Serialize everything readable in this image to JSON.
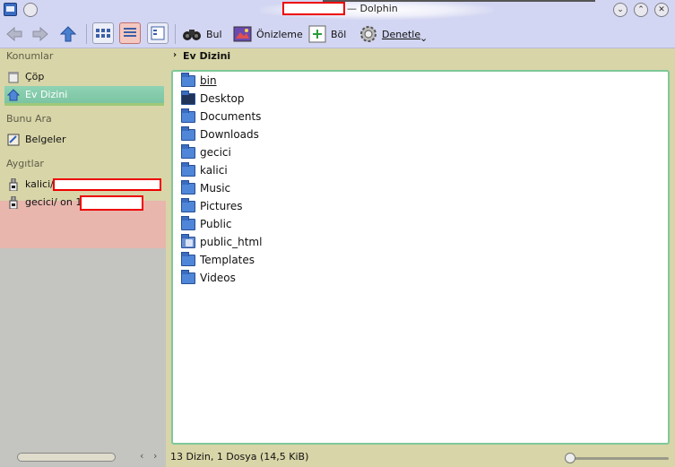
{
  "window": {
    "title": "— Dolphin",
    "minimize_glyph": "⌄",
    "maximize_glyph": "⌃",
    "close_glyph": "✕"
  },
  "toolbar": {
    "find_label": "Bul",
    "preview_label": "Önizleme",
    "split_label": "Böl",
    "control_label": "Denetle",
    "more_glyph": "⌄"
  },
  "sidebar": {
    "places_title": "Konumlar",
    "places": [
      {
        "label": "Çöp",
        "icon": "trash-icon"
      },
      {
        "label": "Ev Dizini",
        "icon": "home-icon",
        "selected": true
      }
    ],
    "search_title": "Bunu Ara",
    "search_items": [
      {
        "label": "Belgeler",
        "icon": "documents-icon"
      }
    ],
    "devices_title": "Aygıtlar",
    "devices": [
      {
        "label": "kalici/",
        "icon": "usb-drive-icon"
      },
      {
        "label": "gecici/ on 1",
        "icon": "usb-drive-icon"
      }
    ]
  },
  "breadcrumb": {
    "label": "Ev Dizini"
  },
  "files": [
    {
      "name": "bin",
      "icon": "folder-bin-icon"
    },
    {
      "name": "Desktop",
      "icon": "desktop-folder-icon"
    },
    {
      "name": "Documents",
      "icon": "folder-icon"
    },
    {
      "name": "Downloads",
      "icon": "folder-icon"
    },
    {
      "name": "gecici",
      "icon": "folder-icon"
    },
    {
      "name": "kalici",
      "icon": "folder-icon"
    },
    {
      "name": "Music",
      "icon": "folder-icon"
    },
    {
      "name": "Pictures",
      "icon": "folder-icon"
    },
    {
      "name": "Public",
      "icon": "folder-icon"
    },
    {
      "name": "public_html",
      "icon": "public-html-folder-icon"
    },
    {
      "name": "Templates",
      "icon": "folder-icon"
    },
    {
      "name": "Videos",
      "icon": "folder-icon"
    }
  ],
  "status": {
    "text": "13 Dizin, 1 Dosya (14,5 KiB)"
  },
  "colors": {
    "sidebar_bg": "#d8d5a8",
    "selection": "#7bc4a3",
    "titlebar_bg": "#d3d6f2",
    "folder": "#4f86d8"
  }
}
